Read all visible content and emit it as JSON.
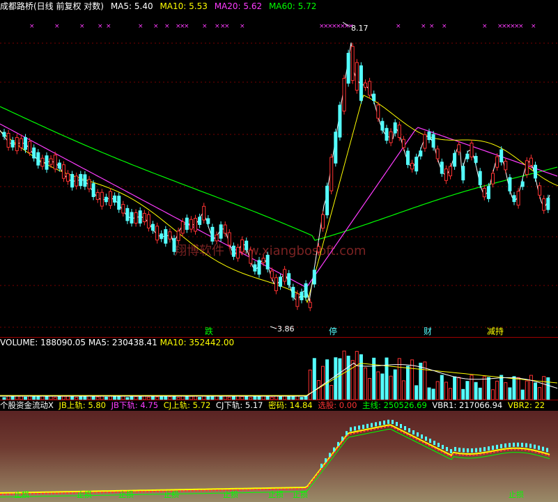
{
  "header": {
    "title": "成都路桥(日线 前复权 对数)",
    "ma5_label": "MA5: 5.40",
    "ma10_label": "MA10: 5.53",
    "ma20_label": "MA20: 5.62",
    "ma60_label": "MA60: 5.72"
  },
  "price_chart": {
    "high_label": "8.17",
    "low_label": "3.86",
    "markers": [
      "跌",
      "停",
      "财",
      "减持"
    ],
    "watermark": "翔博软件 www.xiangbosoft.com"
  },
  "volume_header": {
    "volume": "VOLUME: 188090.05",
    "ma5": "MA5: 230438.41",
    "ma10": "MA10: 352442.00"
  },
  "indicator_header": {
    "name": "个股资金流动X",
    "jb_up": "JB上轨: 5.80",
    "jb_down": "JB下轨: 4.75",
    "cj_up": "CJ上轨: 5.72",
    "cj_down": "CJ下轨: 5.17",
    "density": "密码: 14.84",
    "select": "选股: 0.00",
    "main": "主线: 250526.69",
    "vbr1": "VBR1: 217066.94",
    "vbr2": "VBR2: 22"
  },
  "indicator_labels": [
    "止损",
    "止损",
    "止损",
    "止损",
    "止损",
    "止损",
    "止损",
    "止损"
  ],
  "colors": {
    "up": "#ff3232",
    "down": "#54ffff",
    "ma5": "#ffffff",
    "ma10": "#ffff00",
    "ma20": "#ff3cff",
    "ma60": "#00ff00"
  }
}
